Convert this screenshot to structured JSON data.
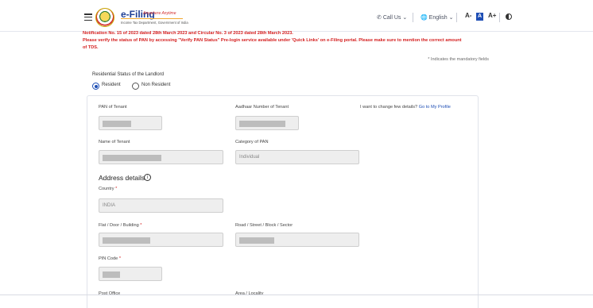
{
  "header": {
    "logo_title": "e-Filing",
    "logo_tagline": "Anywhere Anytime",
    "logo_subtitle": "Income Tax Department, Government of India",
    "call_us": "Call Us",
    "language": "English",
    "font_small": "A-",
    "font_normal": "A",
    "font_large": "A+"
  },
  "notice": {
    "line0": "Notification No. 15 of 2023 dated 28th March 2023 and Circular No. 3 of 2023 dated 28th March 2023.",
    "line1": "Please verify the status of PAN by accessing \"Verify PAN Status\" Pre-login service available under 'Quick Links' on e-Filing portal. Please make sure to mention the correct amount",
    "line2": "of TDS."
  },
  "mandatory_note": "* Indicates the mandatory fields",
  "residential": {
    "label": "Residential Status of the Landlord",
    "options": [
      "Resident",
      "Non Resident"
    ],
    "selected": "Resident"
  },
  "form": {
    "pan_tenant_label": "PAN of Tenant",
    "aadhaar_label": "Aadhaar Number of Tenant",
    "change_details_text": "I want to change few details?",
    "change_details_link": "Go to My Profile",
    "name_label": "Name of Tenant",
    "category_label": "Category of PAN",
    "category_value": "Individual",
    "address_title": "Address details",
    "country_label": "Country",
    "country_value": "INDIA",
    "flat_label": "Flat / Door / Building",
    "road_label": "Road / Street / Block / Sector",
    "pin_label": "PIN Code",
    "post_office_label": "Post Office",
    "area_label": "Area / Locality",
    "required_mark": "*"
  },
  "icons": {
    "menu": "hamburger-icon",
    "phone": "phone-icon",
    "globe": "globe-icon",
    "contrast": "contrast-icon",
    "info": "info-icon"
  },
  "colors": {
    "accent": "#1f4fb5",
    "notice_red": "#d41e1e",
    "field_bg": "#eeeeee"
  }
}
